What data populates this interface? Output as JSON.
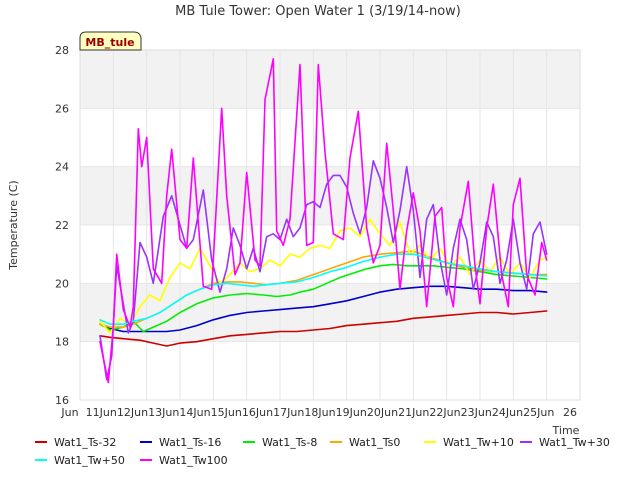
{
  "chart_data": {
    "type": "line",
    "title": "MB Tule Tower: Open Water 1 (3/19/14-now)",
    "xlabel": "Time",
    "ylabel": "Temperature (C)",
    "ylim": [
      16,
      28
    ],
    "xlim": [
      11,
      26
    ],
    "yticks": [
      16,
      18,
      20,
      22,
      24,
      26,
      28
    ],
    "xticks": [
      {
        "value": 11,
        "label": "Jun 11"
      },
      {
        "value": 12,
        "label": "Jun 12"
      },
      {
        "value": 13,
        "label": "Jun 13"
      },
      {
        "value": 14,
        "label": "Jun 14"
      },
      {
        "value": 15,
        "label": "Jun 15"
      },
      {
        "value": 16,
        "label": "Jun 16"
      },
      {
        "value": 17,
        "label": "Jun 17"
      },
      {
        "value": 18,
        "label": "Jun 18"
      },
      {
        "value": 19,
        "label": "Jun 19"
      },
      {
        "value": 20,
        "label": "Jun 20"
      },
      {
        "value": 21,
        "label": "Jun 21"
      },
      {
        "value": 22,
        "label": "Jun 22"
      },
      {
        "value": 23,
        "label": "Jun 23"
      },
      {
        "value": 24,
        "label": "Jun 24"
      },
      {
        "value": 25,
        "label": "Jun 25"
      },
      {
        "value": 26,
        "label": "Jun 26"
      }
    ],
    "x_label_prefix": "Jun",
    "xtick_text": [
      "Jun",
      "11Jun",
      "12Jun",
      "13Jun",
      "14Jun",
      "15Jun",
      "16Jun",
      "17Jun",
      "18Jun",
      "19Jun",
      "20Jun",
      "21Jun",
      "22Jun",
      "23Jun",
      "24Jun",
      "25Jun",
      "26"
    ],
    "grid": true,
    "legend_position": "bottom",
    "annotation_box": "MB_tule",
    "series": [
      {
        "name": "Wat1_Ts-32",
        "color": "#cc0000",
        "x": [
          11.6,
          11.9,
          12.3,
          12.8,
          13.2,
          13.6,
          14.0,
          14.5,
          15.0,
          15.5,
          16.0,
          16.5,
          17.0,
          17.5,
          18.0,
          18.5,
          19.0,
          19.5,
          20.0,
          20.5,
          21.0,
          21.5,
          22.0,
          22.5,
          23.0,
          23.5,
          24.0,
          24.5,
          25.0
        ],
        "y": [
          18.2,
          18.15,
          18.1,
          18.05,
          17.95,
          17.85,
          17.95,
          18.0,
          18.1,
          18.2,
          18.25,
          18.3,
          18.35,
          18.35,
          18.4,
          18.45,
          18.55,
          18.6,
          18.65,
          18.7,
          18.8,
          18.85,
          18.9,
          18.95,
          19.0,
          19.0,
          18.95,
          19.0,
          19.05
        ]
      },
      {
        "name": "Wat1_Ts-16",
        "color": "#0000cc",
        "x": [
          11.6,
          11.9,
          12.3,
          12.8,
          13.2,
          13.6,
          14.0,
          14.5,
          15.0,
          15.5,
          16.0,
          16.5,
          17.0,
          17.5,
          18.0,
          18.5,
          19.0,
          19.5,
          20.0,
          20.5,
          21.0,
          21.5,
          22.0,
          22.5,
          23.0,
          23.5,
          24.0,
          24.5,
          25.0
        ],
        "y": [
          18.6,
          18.45,
          18.35,
          18.35,
          18.35,
          18.35,
          18.4,
          18.55,
          18.75,
          18.9,
          19.0,
          19.05,
          19.1,
          19.15,
          19.2,
          19.3,
          19.4,
          19.55,
          19.7,
          19.8,
          19.85,
          19.9,
          19.9,
          19.85,
          19.8,
          19.8,
          19.75,
          19.75,
          19.7
        ]
      },
      {
        "name": "Wat1_Ts-8",
        "color": "#00ee00",
        "x": [
          11.6,
          11.9,
          12.3,
          12.6,
          12.9,
          13.2,
          13.6,
          14.0,
          14.5,
          15.0,
          15.5,
          16.0,
          16.5,
          16.9,
          17.3,
          17.6,
          18.0,
          18.4,
          18.8,
          19.2,
          19.6,
          20.0,
          20.4,
          20.8,
          21.2,
          21.6,
          22.0,
          22.5,
          23.0,
          23.5,
          24.0,
          24.5,
          25.0
        ],
        "y": [
          18.6,
          18.4,
          18.5,
          18.7,
          18.35,
          18.5,
          18.7,
          19.0,
          19.3,
          19.5,
          19.6,
          19.65,
          19.6,
          19.55,
          19.6,
          19.7,
          19.8,
          20.0,
          20.2,
          20.35,
          20.5,
          20.6,
          20.65,
          20.6,
          20.6,
          20.6,
          20.55,
          20.5,
          20.4,
          20.3,
          20.25,
          20.2,
          20.15
        ]
      },
      {
        "name": "Wat1_Ts0",
        "color": "#ffa500",
        "x": [
          11.6,
          11.9,
          12.3,
          12.6,
          13.0,
          13.4,
          13.8,
          14.2,
          14.6,
          15.0,
          15.4,
          15.8,
          16.2,
          16.6,
          17.0,
          17.5,
          18.0,
          18.5,
          19.0,
          19.5,
          20.0,
          20.5,
          21.0,
          21.5,
          22.0,
          22.5,
          23.0,
          23.5,
          24.0,
          24.5,
          25.0
        ],
        "y": [
          18.6,
          18.5,
          18.5,
          18.6,
          18.8,
          19.0,
          19.3,
          19.6,
          19.8,
          20.0,
          20.05,
          20.05,
          20.0,
          19.95,
          20.0,
          20.1,
          20.3,
          20.5,
          20.7,
          20.9,
          21.0,
          21.05,
          21.1,
          20.9,
          20.7,
          20.55,
          20.45,
          20.4,
          20.35,
          20.3,
          20.3
        ]
      },
      {
        "name": "Wat1_Tw+10",
        "color": "#ffff00",
        "x": [
          11.6,
          11.9,
          12.2,
          12.5,
          12.8,
          13.1,
          13.4,
          13.7,
          14.0,
          14.3,
          14.6,
          14.9,
          15.2,
          15.5,
          15.8,
          16.1,
          16.4,
          16.7,
          17.0,
          17.3,
          17.6,
          17.9,
          18.2,
          18.5,
          18.8,
          19.1,
          19.4,
          19.7,
          20.0,
          20.3,
          20.6,
          20.9,
          21.2,
          21.5,
          21.8,
          22.1,
          22.4,
          22.7,
          23.0,
          23.3,
          23.6,
          23.9,
          24.2,
          24.5,
          24.8,
          25.0
        ],
        "y": [
          18.7,
          18.3,
          18.8,
          18.6,
          19.2,
          19.6,
          19.4,
          20.2,
          20.7,
          20.5,
          21.2,
          20.6,
          20.0,
          20.3,
          20.7,
          20.4,
          20.5,
          20.8,
          20.6,
          21.0,
          20.9,
          21.2,
          21.3,
          21.2,
          21.8,
          21.9,
          21.6,
          22.2,
          21.7,
          21.3,
          22.1,
          21.0,
          21.3,
          20.8,
          21.2,
          20.6,
          20.9,
          20.3,
          20.8,
          20.4,
          20.9,
          20.3,
          20.7,
          20.2,
          20.8,
          20.9
        ]
      },
      {
        "name": "Wat1_Tw+30",
        "color": "#9933ff",
        "x": [
          11.6,
          11.8,
          11.95,
          12.1,
          12.3,
          12.45,
          12.6,
          12.8,
          13.0,
          13.2,
          13.5,
          13.75,
          14.0,
          14.2,
          14.4,
          14.7,
          14.95,
          15.2,
          15.4,
          15.6,
          15.8,
          16.0,
          16.2,
          16.4,
          16.6,
          16.8,
          17.0,
          17.2,
          17.4,
          17.6,
          17.8,
          18.0,
          18.2,
          18.4,
          18.6,
          18.8,
          19.0,
          19.2,
          19.4,
          19.6,
          19.8,
          20.0,
          20.2,
          20.4,
          20.6,
          20.8,
          21.0,
          21.2,
          21.4,
          21.6,
          21.8,
          22.0,
          22.2,
          22.4,
          22.6,
          22.8,
          23.0,
          23.2,
          23.4,
          23.6,
          23.8,
          24.0,
          24.2,
          24.4,
          24.6,
          24.8,
          25.0
        ],
        "y": [
          18.2,
          16.7,
          17.5,
          20.6,
          19.3,
          18.3,
          18.7,
          21.4,
          20.9,
          20.0,
          22.3,
          23.0,
          22.0,
          21.2,
          21.5,
          23.2,
          20.8,
          19.7,
          20.5,
          21.9,
          21.3,
          20.5,
          21.2,
          20.4,
          21.6,
          21.7,
          21.5,
          22.2,
          21.6,
          21.9,
          22.7,
          22.8,
          22.6,
          23.4,
          23.7,
          23.7,
          23.3,
          22.4,
          21.7,
          22.6,
          24.2,
          23.6,
          22.6,
          21.4,
          22.5,
          24.0,
          22.5,
          20.2,
          22.2,
          22.7,
          20.8,
          19.6,
          21.2,
          22.2,
          21.5,
          19.8,
          20.7,
          22.1,
          21.6,
          20.0,
          20.8,
          22.2,
          20.7,
          19.8,
          21.7,
          22.1,
          21.0
        ]
      },
      {
        "name": "Wat1_Tw+50",
        "color": "#00ffff",
        "x": [
          11.6,
          11.9,
          12.3,
          12.6,
          13.0,
          13.4,
          13.8,
          14.2,
          14.6,
          15.0,
          15.4,
          15.8,
          16.2,
          16.6,
          17.0,
          17.5,
          18.0,
          18.5,
          19.0,
          19.5,
          20.0,
          20.5,
          21.0,
          21.5,
          22.0,
          22.5,
          23.0,
          23.5,
          24.0,
          24.5,
          25.0
        ],
        "y": [
          18.75,
          18.6,
          18.6,
          18.7,
          18.8,
          19.0,
          19.3,
          19.6,
          19.8,
          19.95,
          20.0,
          19.95,
          19.9,
          19.95,
          20.0,
          20.05,
          20.2,
          20.4,
          20.55,
          20.75,
          20.9,
          21.0,
          21.0,
          20.85,
          20.7,
          20.6,
          20.5,
          20.4,
          20.35,
          20.3,
          20.25
        ]
      },
      {
        "name": "Wat1_Tw100",
        "color": "#ff00ff",
        "x": [
          11.6,
          11.85,
          12.0,
          12.1,
          12.3,
          12.5,
          12.6,
          12.75,
          12.85,
          13.0,
          13.2,
          13.45,
          13.6,
          13.75,
          14.0,
          14.2,
          14.4,
          14.7,
          14.95,
          15.25,
          15.4,
          15.65,
          15.8,
          16.0,
          16.25,
          16.4,
          16.55,
          16.8,
          16.9,
          17.1,
          17.3,
          17.6,
          17.8,
          18.0,
          18.15,
          18.35,
          18.6,
          18.9,
          19.1,
          19.35,
          19.6,
          19.8,
          20.0,
          20.2,
          20.4,
          20.6,
          20.8,
          21.0,
          21.2,
          21.4,
          21.65,
          21.85,
          22.0,
          22.2,
          22.4,
          22.65,
          22.85,
          23.0,
          23.2,
          23.4,
          23.65,
          23.85,
          24.0,
          24.2,
          24.4,
          24.65,
          24.85,
          25.0
        ],
        "y": [
          18.0,
          16.6,
          18.5,
          21.0,
          19.1,
          18.5,
          19.2,
          25.3,
          24.0,
          25.0,
          20.5,
          20.0,
          23.0,
          24.6,
          21.5,
          21.2,
          24.3,
          19.9,
          19.8,
          26.0,
          23.0,
          20.3,
          20.7,
          23.8,
          20.8,
          20.6,
          26.3,
          27.7,
          21.8,
          21.3,
          22.2,
          27.5,
          21.3,
          21.4,
          27.5,
          24.5,
          21.7,
          21.5,
          24.3,
          25.9,
          21.9,
          20.7,
          21.3,
          24.8,
          22.5,
          19.8,
          21.8,
          23.1,
          21.8,
          19.2,
          22.3,
          22.6,
          20.2,
          19.2,
          21.9,
          23.5,
          20.6,
          19.3,
          21.9,
          23.4,
          20.3,
          19.2,
          22.7,
          23.6,
          20.3,
          19.6,
          21.4,
          20.8
        ]
      }
    ]
  }
}
